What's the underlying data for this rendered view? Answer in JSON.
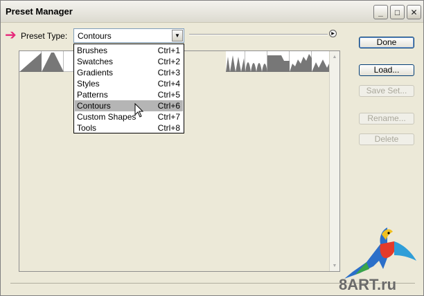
{
  "window": {
    "title": "Preset Manager",
    "controls": {
      "minimize": "_",
      "maximize": "□",
      "close": "✕"
    }
  },
  "preset_type": {
    "label": "Preset Type:",
    "value": "Contours"
  },
  "dropdown": {
    "items": [
      {
        "label": "Brushes",
        "shortcut": "Ctrl+1"
      },
      {
        "label": "Swatches",
        "shortcut": "Ctrl+2"
      },
      {
        "label": "Gradients",
        "shortcut": "Ctrl+3"
      },
      {
        "label": "Styles",
        "shortcut": "Ctrl+4"
      },
      {
        "label": "Patterns",
        "shortcut": "Ctrl+5"
      },
      {
        "label": "Contours",
        "shortcut": "Ctrl+6"
      },
      {
        "label": "Custom Shapes",
        "shortcut": "Ctrl+7"
      },
      {
        "label": "Tools",
        "shortcut": "Ctrl+8"
      }
    ],
    "selected_index": 5
  },
  "buttons": {
    "done": "Done",
    "load": "Load...",
    "save_set": "Save Set...",
    "rename": "Rename...",
    "delete": "Delete"
  },
  "watermark": {
    "text": "8ART.ru"
  },
  "colors": {
    "accent_arrow": "#e6287a",
    "selected_item": "#b5b5b5",
    "window_bg": "#ece9d8"
  }
}
